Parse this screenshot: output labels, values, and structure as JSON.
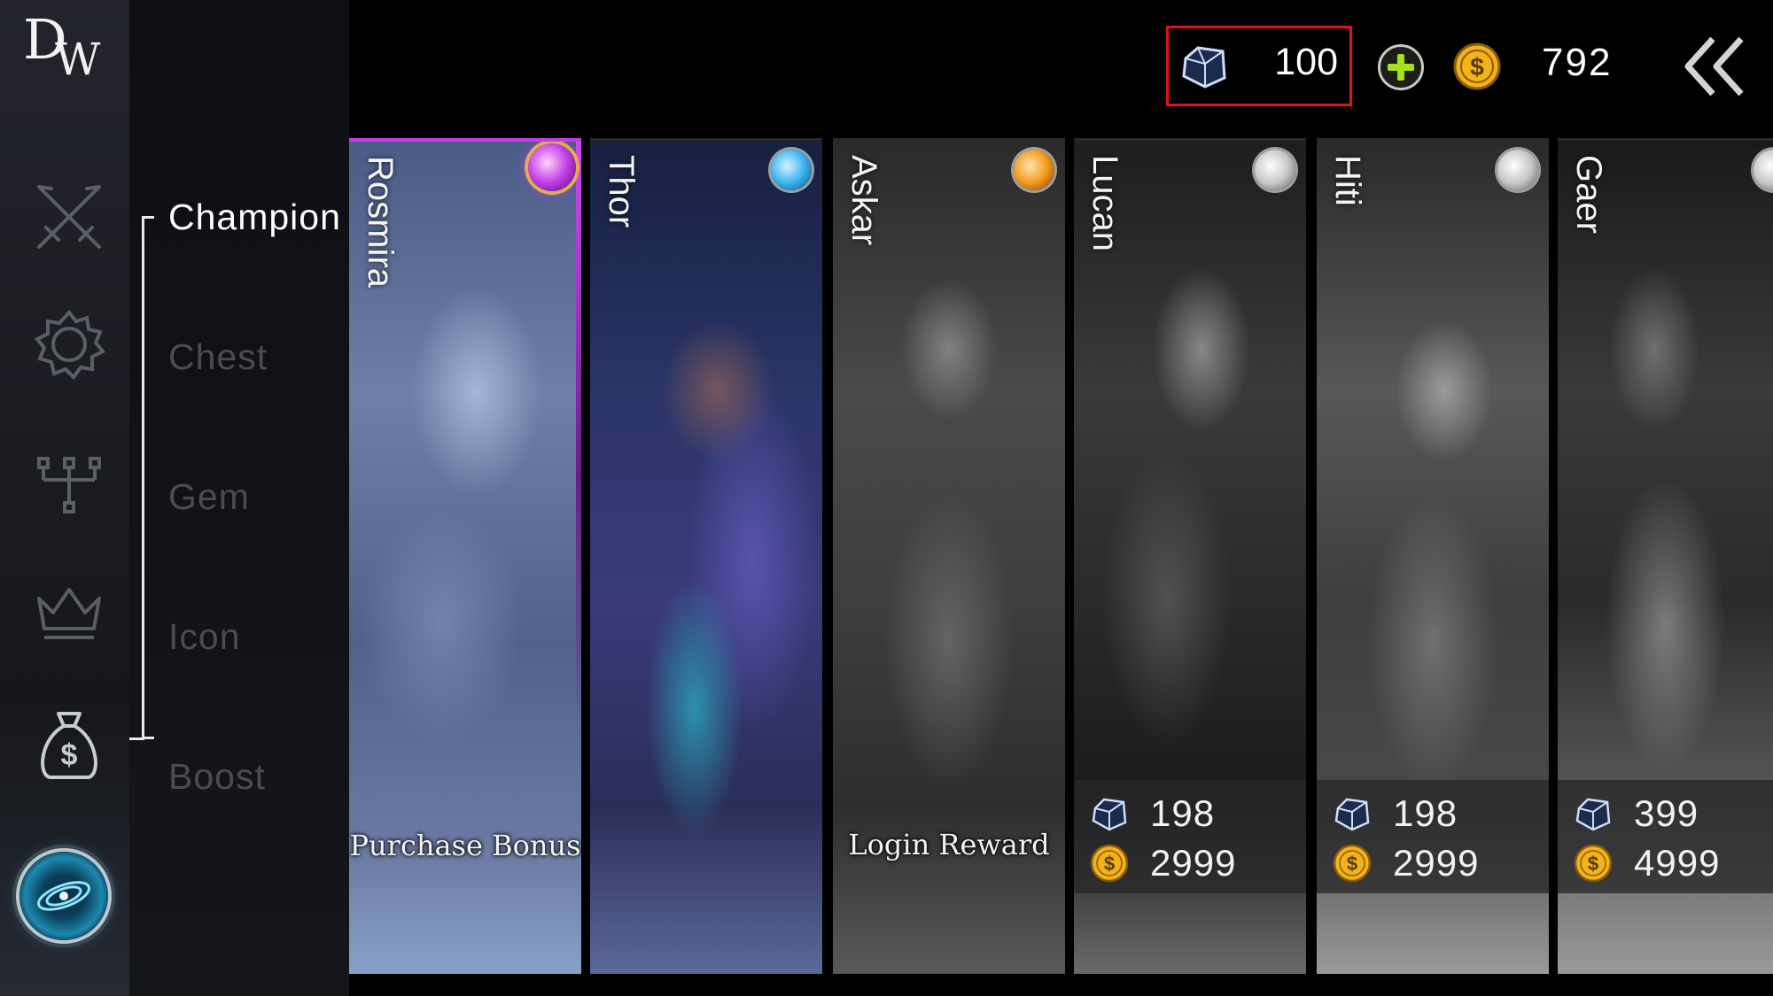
{
  "app": {
    "logo_text_d": "D",
    "logo_text_w": "W"
  },
  "rail": {
    "icons": [
      "crossed-swords-icon",
      "settings-gear-icon",
      "tree-hierarchy-icon",
      "crown-icon",
      "money-bag-icon"
    ],
    "orb": "portal-orb-icon"
  },
  "menu": {
    "items": [
      {
        "label": "Champion",
        "active": true
      },
      {
        "label": "Chest",
        "active": false
      },
      {
        "label": "Gem",
        "active": false
      },
      {
        "label": "Icon",
        "active": false
      },
      {
        "label": "Boost",
        "active": false
      }
    ]
  },
  "topbar": {
    "gems": "100",
    "coins": "792",
    "plus_icon": "plus-icon",
    "back_icon": "double-chevron-left-icon"
  },
  "colors": {
    "highlight_box": "#e0111b",
    "coin": "#f2b21a",
    "plus": "#a6e21b",
    "epic": "#c23ee6",
    "rare": "#3bb4f0",
    "legendary": "#f39a1d",
    "common": "#d8d8d8"
  },
  "cards": [
    {
      "name": "Rosmira",
      "rarity": "epic",
      "tag": "Purchase Bonus"
    },
    {
      "name": "Thor",
      "rarity": "rare",
      "tag": ""
    },
    {
      "name": "Askar",
      "rarity": "legendary",
      "tag": "Login Reward"
    },
    {
      "name": "Lucan",
      "rarity": "common",
      "gem_price": "198",
      "coin_price": "2999"
    },
    {
      "name": "Hiti",
      "rarity": "common",
      "gem_price": "198",
      "coin_price": "2999"
    },
    {
      "name": "Gaer",
      "rarity": "common",
      "gem_price": "399",
      "coin_price": "4999"
    }
  ]
}
